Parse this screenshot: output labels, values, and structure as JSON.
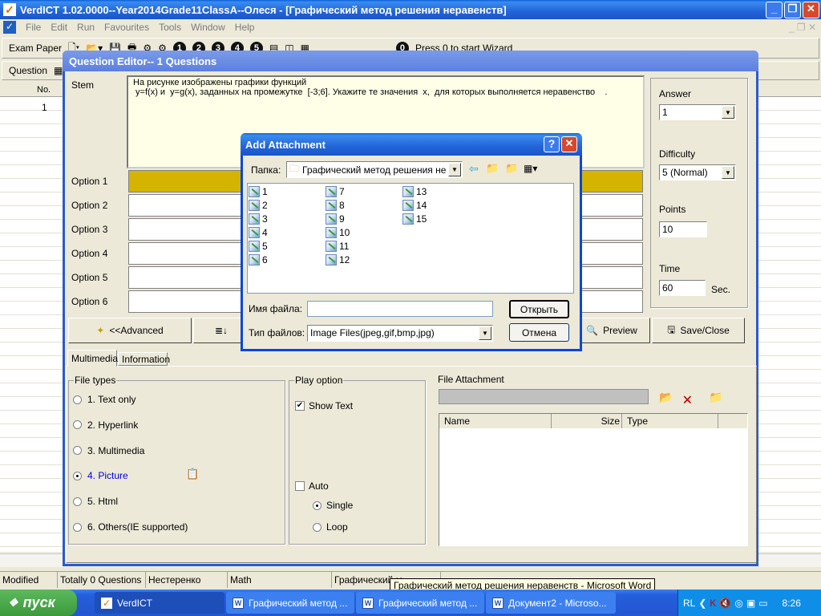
{
  "app": {
    "title": "VerdICT 1.02.0000--Year2014Grade11ClassA--Олеся - [Графический метод решения неравенств]",
    "menu": [
      "File",
      "Edit",
      "Run",
      "Favourites",
      "Tools",
      "Window",
      "Help"
    ],
    "toolbar1": {
      "label": "Exam Paper",
      "numbers": [
        "1",
        "2",
        "3",
        "4",
        "5"
      ],
      "wizard_circle": "0",
      "wizard": "Press 0 to start Wizard"
    },
    "toolbar2": {
      "label": "Question"
    },
    "grid": {
      "header": "No.",
      "rows": [
        "1"
      ]
    }
  },
  "editor": {
    "title": "Question Editor-- 1 Questions",
    "stem_label": "Stem",
    "stem_text": "На рисунке изображены графики функций\n y=f(x) и  y=g(x), заданных на промежутке  [-3;6]. Укажите те значения  x,  для которых выполняется неравенство    .",
    "options": [
      "Option 1",
      "Option 2",
      "Option 3",
      "Option 4",
      "Option 5",
      "Option 6"
    ],
    "answer_label": "Answer",
    "answer_value": "1",
    "difficulty_label": "Difficulty",
    "difficulty_value": "5 (Normal)",
    "points_label": "Points",
    "points_value": "10",
    "time_label": "Time",
    "time_value": "60",
    "time_unit": "Sec.",
    "buttons": {
      "advanced": "<<Advanced",
      "preview": "Preview",
      "save_close": "Save/Close"
    },
    "tabs": [
      "Multimedia",
      "Information"
    ],
    "file_types_title": "File types",
    "file_types": [
      {
        "label": "1. Text only",
        "selected": false
      },
      {
        "label": "2. Hyperlink",
        "selected": false
      },
      {
        "label": "3. Multimedia",
        "selected": false
      },
      {
        "label": "4. Picture",
        "selected": true
      },
      {
        "label": "5. Html",
        "selected": false
      },
      {
        "label": "6. Others(IE supported)",
        "selected": false
      }
    ],
    "play_title": "Play option",
    "show_text": "Show Text",
    "show_text_checked": true,
    "auto": "Auto",
    "auto_checked": false,
    "single": "Single",
    "loop": "Loop",
    "attachment_title": "File Attachment",
    "attach_columns": [
      "Name",
      "Size",
      "Type"
    ]
  },
  "dialog": {
    "title": "Add Attachment",
    "help": "?",
    "folder_label": "Папка:",
    "folder_value": "Графический метод решения нера",
    "files": [
      "1",
      "2",
      "3",
      "4",
      "5",
      "6",
      "7",
      "8",
      "9",
      "10",
      "11",
      "12",
      "13",
      "14",
      "15"
    ],
    "filename_label": "Имя файла:",
    "filename_value": "",
    "filetype_label": "Тип файлов:",
    "filetype_value": "Image Files(jpeg,gif,bmp,jpg)",
    "open": "Открыть",
    "cancel": "Отмена"
  },
  "status": [
    "Modified",
    "Totally 0 Questions",
    "Нестеренко",
    "Math",
    "Графический м"
  ],
  "tooltip": "Графический метод решения неравенств - Microsoft Word",
  "taskbar": {
    "start": "пуск",
    "items": [
      "VerdICT",
      "Графический метод ...",
      "Графический метод ...",
      "Документ2 - Microso..."
    ],
    "lang": "RL",
    "clock": "8:26"
  },
  "colors": {
    "title_blue": "#2264d8",
    "option_selected": "#d4b400",
    "stem_bg": "#ffffe8",
    "taskbar": "#245edb",
    "start": "#3c9a3c"
  }
}
